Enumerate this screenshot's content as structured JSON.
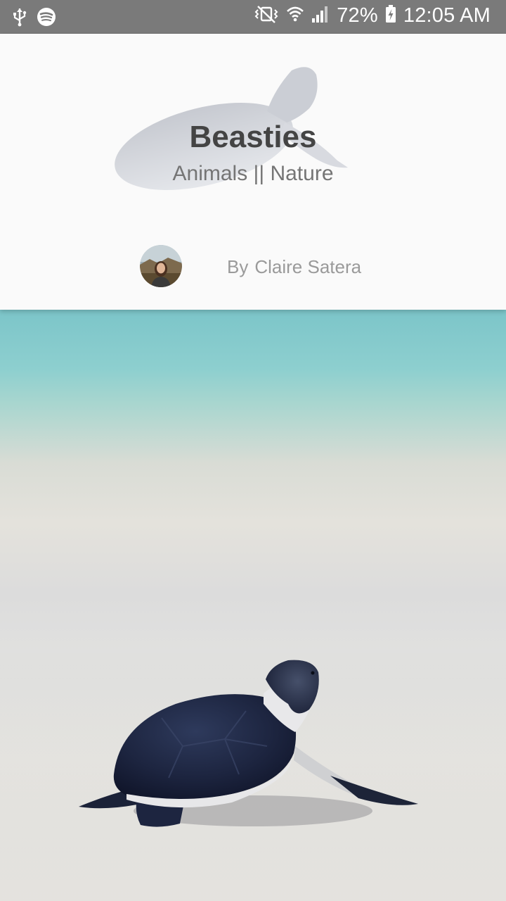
{
  "status_bar": {
    "battery": "72%",
    "time": "12:05 AM",
    "icons": [
      "usb-icon",
      "spotify-icon",
      "vibrate-off-icon",
      "wifi-icon",
      "signal-icon",
      "battery-charging-icon"
    ]
  },
  "header": {
    "title": "Beasties",
    "subtitle": "Animals || Nature",
    "by_label": "By",
    "author": "Claire Satera"
  },
  "colors": {
    "status_bar_bg": "#7a7a7a",
    "header_bg": "#fafafa",
    "title": "#444444",
    "subtitle": "#757575",
    "byline": "#9a9a9a",
    "turtle_shell": "#1d2540"
  }
}
